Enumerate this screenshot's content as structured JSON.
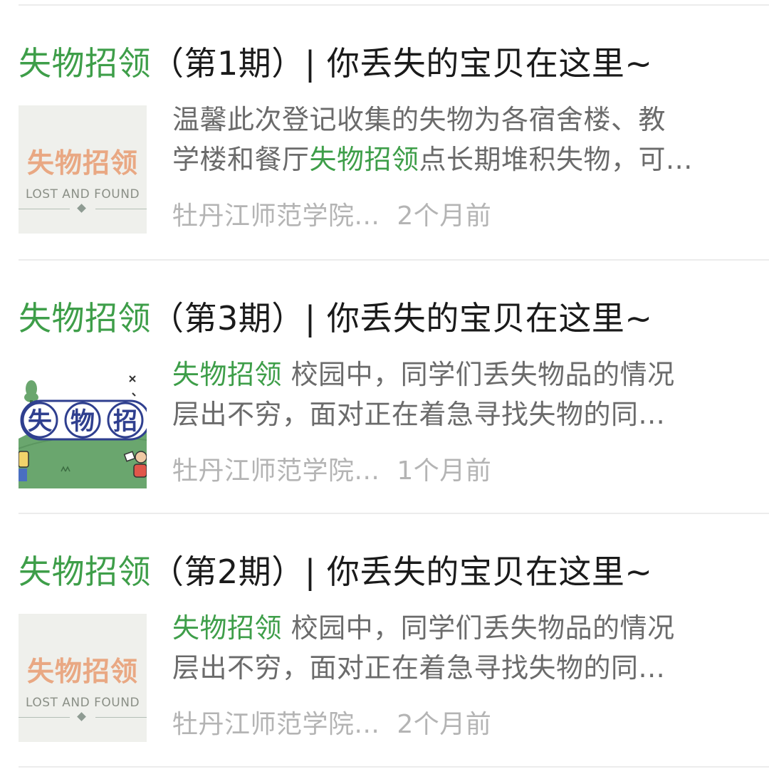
{
  "articles": [
    {
      "title_keyword": "失物招领",
      "title_rest": "（第1期）| 你丢失的宝贝在这里~",
      "summary_line1": "温馨此次登记收集的失物为各宿舍楼、教",
      "summary_line2_pre": "学楼和餐厅",
      "summary_line2_keyword": "失物招领",
      "summary_line2_post": "点长期堆积失物，可...",
      "source": "牡丹江师范学院...",
      "time": "2个月前",
      "thumb": {
        "style": "lost-and-found-card",
        "cn": "失物招领",
        "en": "LOST AND FOUND"
      }
    },
    {
      "title_keyword": "失物招领",
      "title_rest": "（第3期）| 你丢失的宝贝在这里~",
      "summary_line1_keyword": "失物招领",
      "summary_line1_post": " 校园中，同学们丢失物品的情况",
      "summary_line2": "层出不穷，面对正在着急寻找失物的同...",
      "source": "牡丹江师范学院...",
      "time": "1个月前",
      "thumb": {
        "style": "cartoon-illustration",
        "chars": [
          "失",
          "物",
          "招"
        ]
      }
    },
    {
      "title_keyword": "失物招领",
      "title_rest": "（第2期）| 你丢失的宝贝在这里~",
      "summary_line1_keyword": "失物招领",
      "summary_line1_post": " 校园中，同学们丢失物品的情况",
      "summary_line2": "层出不穷，面对正在着急寻找失物的同...",
      "source": "牡丹江师范学院...",
      "time": "2个月前",
      "thumb": {
        "style": "lost-and-found-card",
        "cn": "失物招领",
        "en": "LOST AND FOUND"
      }
    }
  ],
  "colors": {
    "highlight": "#3e9e49",
    "title": "#1a1a1a",
    "summary": "#6b6b6b",
    "meta": "#b4b4b4",
    "divider": "#ececec"
  }
}
